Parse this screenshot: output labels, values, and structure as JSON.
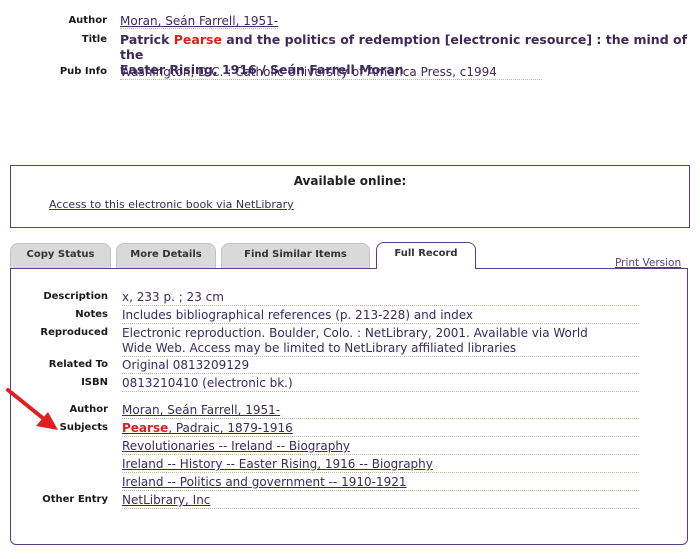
{
  "header": {
    "author_label": "Author",
    "author_value": "Moran, Seán Farrell, 1951-",
    "title_label": "Title",
    "title_pre": "Patrick ",
    "title_highlight": "Pearse",
    "title_line1_rest": " and the politics of redemption [electronic resource] : the mind of the",
    "title_line2": "Easter Rising, 1916 / Seán Farrell Moran",
    "pubinfo_label": "Pub Info",
    "pubinfo_value": "Washington, D.C. : Catholic University of America Press, c1994"
  },
  "available": {
    "title": "Available online:",
    "link": "Access to this electronic book via NetLibrary"
  },
  "tabs": [
    {
      "label": "Copy Status"
    },
    {
      "label": "More Details"
    },
    {
      "label": "Find Similar Items"
    },
    {
      "label": "Full Record"
    }
  ],
  "print_version": "Print Version",
  "record": {
    "description_label": "Description",
    "description": "x, 233 p. ; 23 cm",
    "notes_label": "Notes",
    "notes": "Includes bibliographical references (p. 213-228) and index",
    "reproduced_label": "Reproduced",
    "reproduced_line1": "Electronic reproduction. Boulder, Colo. : NetLibrary, 2001. Available via World",
    "reproduced_line2": "Wide Web. Access may be limited to NetLibrary affiliated libraries",
    "related_label": "Related To",
    "related": "Original 0813209129",
    "isbn_label": "ISBN",
    "isbn": "0813210410 (electronic bk.)",
    "author_label": "Author",
    "author": "Moran, Seán Farrell, 1951-",
    "subjects_label": "Subjects",
    "subject1_highlight": "Pearse",
    "subject1_rest": ", Padraic, 1879-1916",
    "subject2": "Revolutionaries -- Ireland -- Biography",
    "subject3": "Ireland -- History -- Easter Rising, 1916 -- Biography",
    "subject4": "Ireland -- Politics and government -- 1910-1921",
    "other_label": "Other Entry",
    "other": "NetLibrary, Inc"
  },
  "colors": {
    "accent": "#5b3f86",
    "highlight": "#d0251c",
    "arrow": "#e02020"
  }
}
